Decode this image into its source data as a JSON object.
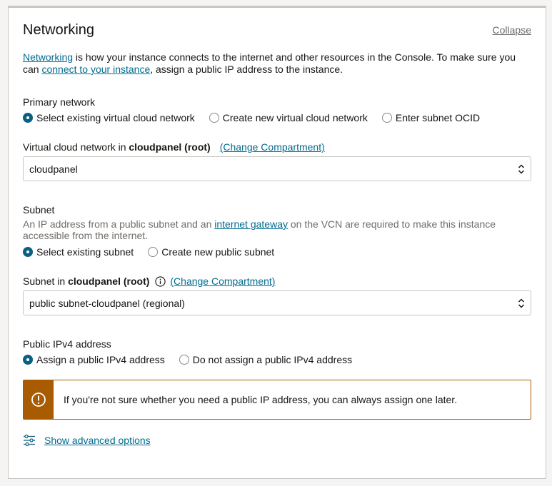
{
  "panel": {
    "title": "Networking",
    "collapse_label": "Collapse"
  },
  "intro": {
    "link1": "Networking",
    "text1": " is how your instance connects to the internet and other resources in the Console. To make sure you can ",
    "link2": "connect to your instance",
    "text2": ", assign a public IP address to the instance."
  },
  "primary_network": {
    "label": "Primary network",
    "options": [
      {
        "label": "Select existing virtual cloud network",
        "checked": true
      },
      {
        "label": "Create new virtual cloud network",
        "checked": false
      },
      {
        "label": "Enter subnet OCID",
        "checked": false
      }
    ]
  },
  "vcn": {
    "label_prefix": "Virtual cloud network in ",
    "compartment": "cloudpanel (root)",
    "change_link": "(Change Compartment)",
    "value": "cloudpanel"
  },
  "subnet": {
    "label": "Subnet",
    "help_text1": "An IP address from a public subnet and an ",
    "help_link": "internet gateway",
    "help_text2": " on the VCN are required to make this instance accessible from the internet.",
    "options": [
      {
        "label": "Select existing subnet",
        "checked": true
      },
      {
        "label": "Create new public subnet",
        "checked": false
      }
    ],
    "field_label_prefix": "Subnet in ",
    "compartment": "cloudpanel (root)",
    "change_link": "(Change Compartment)",
    "value": "public subnet-cloudpanel (regional)"
  },
  "public_ip": {
    "label": "Public IPv4 address",
    "options": [
      {
        "label": "Assign a public IPv4 address",
        "checked": true
      },
      {
        "label": "Do not assign a public IPv4 address",
        "checked": false
      }
    ]
  },
  "alert": {
    "text": "If you're not sure whether you need a public IP address, you can always assign one later."
  },
  "advanced": {
    "label": "Show advanced options"
  },
  "colors": {
    "link": "#006b8f",
    "radio_checked": "#0a5f82",
    "warning": "#a85b00"
  },
  "icons": {
    "select_chevron": "chevron-up-down-icon",
    "info": "info-icon",
    "warning": "exclamation-circle-icon",
    "advanced": "sliders-icon"
  }
}
